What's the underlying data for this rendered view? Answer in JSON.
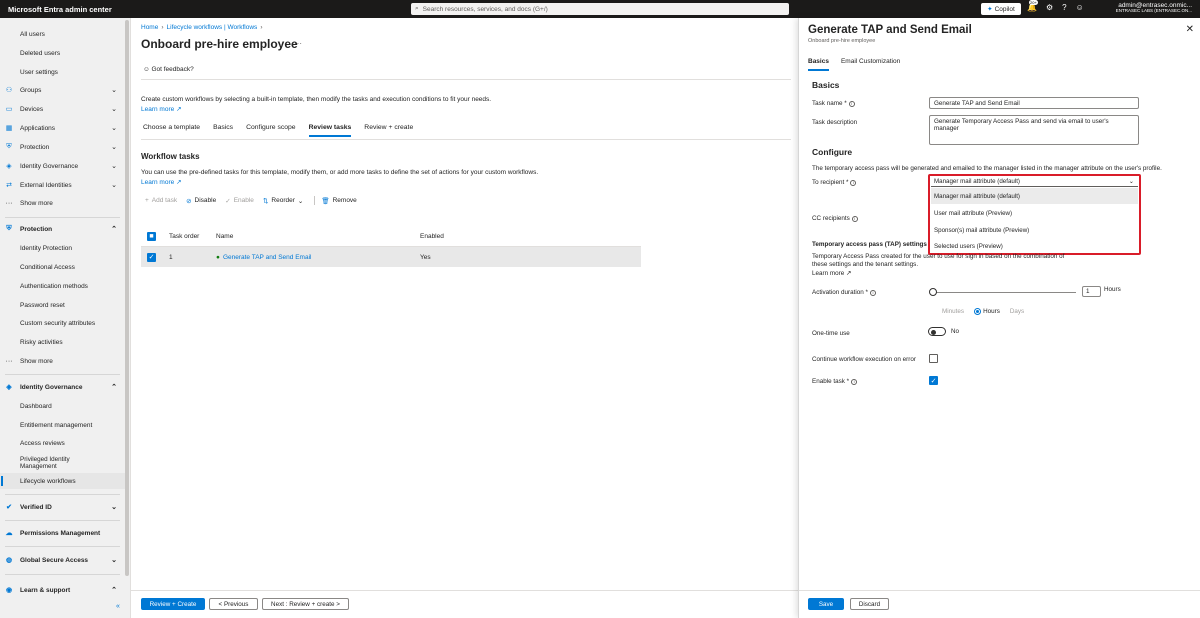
{
  "topbar": {
    "brand": "Microsoft Entra admin center",
    "search_placeholder": "Search resources, services, and docs (G+/)",
    "copilot_label": "Copilot",
    "notification_badge": "20+",
    "account_email": "admin@entrasec.onmic...",
    "account_tenant": "ENTRASEC LABS (ENTRASEC.ON..."
  },
  "sidebar": {
    "users_sub": [
      "All users",
      "Deleted users",
      "User settings"
    ],
    "groups": [
      {
        "label": "Groups",
        "icon": "groups-icon"
      },
      {
        "label": "Devices",
        "icon": "devices-icon"
      },
      {
        "label": "Applications",
        "icon": "applications-icon"
      },
      {
        "label": "Protection",
        "icon": "protection-icon"
      },
      {
        "label": "Identity Governance",
        "icon": "identity-governance-icon"
      },
      {
        "label": "External Identities",
        "icon": "external-identities-icon"
      }
    ],
    "show_more_1": "Show more",
    "protection_header": "Protection",
    "protection_items": [
      "Identity Protection",
      "Conditional Access",
      "Authentication methods",
      "Password reset",
      "Custom security attributes",
      "Risky activities"
    ],
    "show_more_2": "Show more",
    "governance_header": "Identity Governance",
    "governance_items": [
      "Dashboard",
      "Entitlement management",
      "Access reviews",
      "Privileged Identity Management",
      "Lifecycle workflows"
    ],
    "verified_id": "Verified ID",
    "permissions_management": "Permissions Management",
    "global_secure_access": "Global Secure Access",
    "learn_support": "Learn & support"
  },
  "main": {
    "breadcrumb": [
      "Home",
      "Lifecycle workflows | Workflows"
    ],
    "title": "Onboard pre-hire employee",
    "feedback": "Got feedback?",
    "description": "Create custom workflows by selecting a built-in template, then modify the tasks and execution conditions to fit your needs.",
    "learn_more": "Learn more",
    "tabs": [
      "Choose a template",
      "Basics",
      "Configure scope",
      "Review tasks",
      "Review + create"
    ],
    "active_tab": "Review tasks",
    "workflow_tasks_title": "Workflow tasks",
    "workflow_tasks_desc": "You can use the pre-defined tasks for this template, modify them, or add more tasks to define the set of actions for your custom workflows.",
    "learn_more_2": "Learn more",
    "toolbar": {
      "add_task": "Add task",
      "disable": "Disable",
      "enable": "Enable",
      "reorder": "Reorder",
      "remove": "Remove"
    },
    "table": {
      "headers": [
        "Task order",
        "Name",
        "Enabled"
      ],
      "rows": [
        {
          "order": "1",
          "name": "Generate TAP and Send Email",
          "enabled": "Yes"
        }
      ]
    },
    "footer": {
      "review_create": "Review + Create",
      "previous": "< Previous",
      "next": "Next : Review + create >"
    }
  },
  "panel": {
    "title": "Generate TAP and Send Email",
    "subtitle": "Onboard pre-hire employee",
    "tabs": [
      "Basics",
      "Email Customization"
    ],
    "basics_heading": "Basics",
    "task_name_label": "Task name *",
    "task_name_value": "Generate TAP and Send Email",
    "task_desc_label": "Task description",
    "task_desc_value": "Generate Temporary Access Pass and send via email to user's manager",
    "configure_heading": "Configure",
    "configure_desc": "The temporary access pass will be generated and emailed to the manager listed in the manager attribute on the user's profile.",
    "to_recipient_label": "To recipient *",
    "to_recipient_value": "Manager mail attribute (default)",
    "recipient_options": [
      "Manager mail attribute (default)",
      "User mail attribute (Preview)",
      "Sponsor(s) mail attribute (Preview)",
      "Selected users (Preview)"
    ],
    "cc_label": "CC recipients",
    "tap_heading": "Temporary access pass (TAP) settings",
    "tap_desc": "Temporary Access Pass created for the user to use for sign in based on the combination of these settings and the tenant settings.",
    "tap_learn_more": "Learn more",
    "activation_label": "Activation duration *",
    "activation_value": "1",
    "activation_unit": "Hours",
    "units": [
      "Minutes",
      "Hours",
      "Days"
    ],
    "selected_unit": "Hours",
    "one_time_label": "One-time use",
    "one_time_value": "No",
    "continue_label": "Continue workflow execution on error",
    "enable_task_label": "Enable task *",
    "save": "Save",
    "discard": "Discard"
  },
  "colors": {
    "accent": "#0078d4",
    "highlight_border": "#d91c29",
    "topbar": "#1b1a19",
    "success": "#107c10"
  }
}
